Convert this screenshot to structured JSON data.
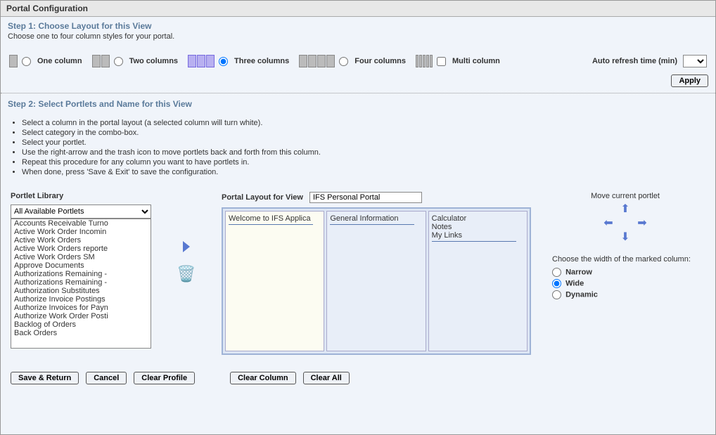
{
  "title": "Portal Configuration",
  "step1": {
    "title": "Step 1: Choose Layout for this View",
    "desc": "Choose one to four column styles for your portal.",
    "options": {
      "one": "One column",
      "two": "Two columns",
      "three": "Three columns",
      "four": "Four columns",
      "multi": "Multi column"
    },
    "selected": "three",
    "refresh_label": "Auto refresh time (min)",
    "apply": "Apply"
  },
  "step2": {
    "title": "Step 2: Select Portlets and Name for this View",
    "instructions": [
      "Select a column in the portal layout (a selected column will turn white).",
      "Select category in the combo-box.",
      "Select your portlet.",
      "Use the right-arrow and the trash icon to move portlets back and forth from this column.",
      "Repeat this procedure for any column you want to have portlets in.",
      "When done, press 'Save & Exit' to save the configuration."
    ]
  },
  "library": {
    "heading": "Portlet Library",
    "category": "All Available Portlets",
    "items": [
      "Accounts Receivable Turno",
      "Active Work Order Incomin",
      "Active Work Orders",
      "Active Work Orders reporte",
      "Active Work Orders SM",
      "Approve Documents",
      "Authorizations Remaining -",
      "Authorizations Remaining -",
      "Authorization Substitutes",
      "Authorize Invoice Postings",
      "Authorize Invoices for Payn",
      "Authorize Work Order Posti",
      "Backlog of Orders",
      "Back Orders"
    ]
  },
  "preview": {
    "heading": "Portal Layout for View",
    "view_name": "IFS Personal Portal",
    "columns": [
      [
        "Welcome to IFS Applica"
      ],
      [
        "General Information"
      ],
      [
        "Calculator",
        "Notes",
        "My Links"
      ]
    ]
  },
  "move": {
    "heading": "Move current portlet",
    "width_heading": "Choose the width of the marked column:",
    "options": {
      "narrow": "Narrow",
      "wide": "Wide",
      "dynamic": "Dynamic"
    },
    "selected": "wide"
  },
  "buttons": {
    "save": "Save & Return",
    "cancel": "Cancel",
    "clear_profile": "Clear Profile",
    "clear_column": "Clear Column",
    "clear_all": "Clear All"
  }
}
